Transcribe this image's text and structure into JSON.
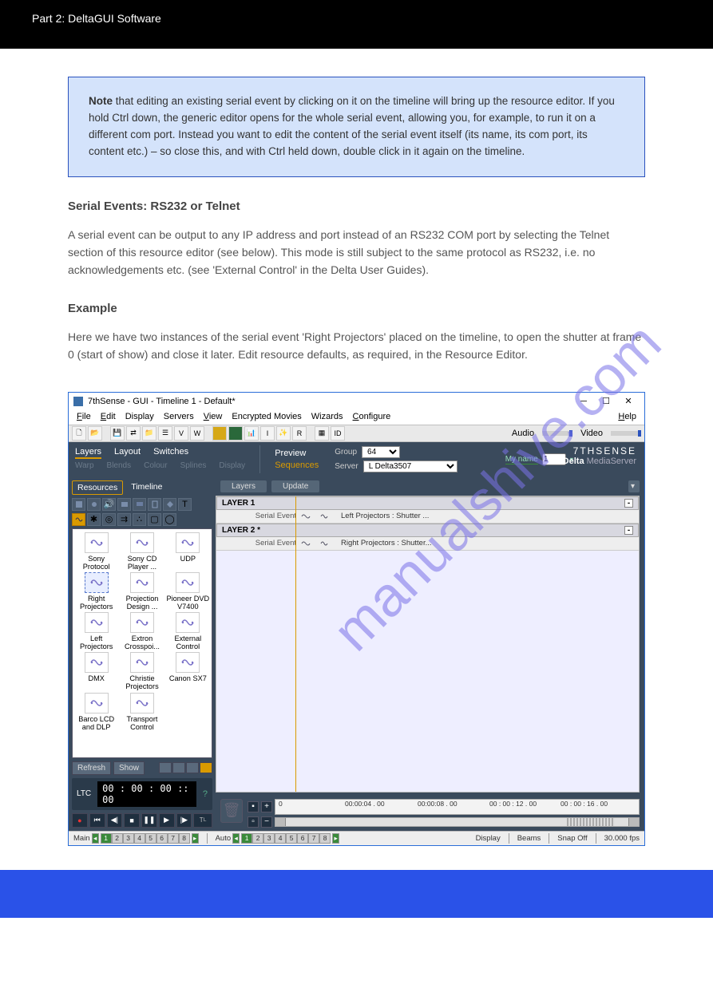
{
  "header": {
    "title": "Part 2: DeltaGUI Software"
  },
  "note": {
    "label": "Note",
    "text": " that editing an existing serial event by clicking on it on the timeline will bring up the resource editor. If you hold Ctrl down, the generic editor opens for the whole serial event, allowing you, for example, to run it on a different com port. Instead you want to edit the content of the serial event itself (its name, its com port, its content etc.) – so close this, and with Ctrl held down, double click in it again on the timeline."
  },
  "body": {
    "h1": "Serial Events: RS232 or Telnet",
    "p1": "A serial event can be output to any IP address and port instead of an RS232 COM port by selecting the Telnet section of this resource editor (see below). This mode is still subject to the same protocol as RS232, i.e. no acknowledgements etc. (see 'External Control' in the Delta User Guides).",
    "h2": "Example",
    "p2": "Here we have two instances of the serial event 'Right Projectors' placed on the timeline, to open the shutter at frame 0 (start of show) and close it later. Edit resource defaults, as required, in the Resource Editor."
  },
  "app": {
    "title": "7thSense -   GUI  - Timeline 1  - Default*",
    "menubar": [
      "File",
      "Edit",
      "Display",
      "Servers",
      "View",
      "Encrypted Movies",
      "Wizards",
      "Configure"
    ],
    "menubar_help": "Help",
    "toolbar_audio": "Audio",
    "toolbar_video": "Video",
    "tabs_main": [
      "Layers",
      "Layout",
      "Switches"
    ],
    "tabs_sub": [
      "Warp",
      "Blends",
      "Colour",
      "Splines",
      "Display"
    ],
    "mid": {
      "preview": "Preview",
      "sequences": "Sequences"
    },
    "group_label": "Group",
    "group_value": "64",
    "server_label": "Server",
    "server_value": "L   Delta3507",
    "myname_label": "My name",
    "myname_value": "1",
    "brand_logo": "7THSENSE",
    "brand_sub_a": "Delta",
    "brand_sub_b": " MediaServer",
    "res_tabs": {
      "resources": "Resources",
      "timeline": "Timeline"
    },
    "resources": [
      {
        "name": "Sony Protocol"
      },
      {
        "name": "Sony CD Player ..."
      },
      {
        "name": "UDP"
      },
      {
        "name": "Right Projectors",
        "selected": true
      },
      {
        "name": "Projection Design ..."
      },
      {
        "name": "Pioneer DVD V7400"
      },
      {
        "name": "Left Projectors"
      },
      {
        "name": "Extron Crosspoi..."
      },
      {
        "name": "External Control"
      },
      {
        "name": "DMX"
      },
      {
        "name": "Christie Projectors"
      },
      {
        "name": "Canon SX7"
      },
      {
        "name": "Barco LCD and DLP"
      },
      {
        "name": "Transport Control"
      }
    ],
    "left_buttons": {
      "refresh": "Refresh",
      "show": "Show"
    },
    "ltc": {
      "label": "LTC",
      "time": "00 : 00 : 00 :: 00"
    },
    "tl_header": {
      "layers": "Layers",
      "update": "Update"
    },
    "layer1": {
      "head": "LAYER 1",
      "track": "Serial Event",
      "clip": "Left Projectors : Shutter ..."
    },
    "layer2": {
      "head": "LAYER 2 *",
      "track": "Serial Event",
      "clip": "Right Projectors : Shutter..."
    },
    "ruler": {
      "t0": "0",
      "t1": "00:00:04 . 00",
      "t2": "00:00:08 . 00",
      "t3": "00 : 00 : 12 . 00",
      "t4": "00 : 00 : 16 . 00"
    },
    "status": {
      "main": "Main",
      "auto": "Auto",
      "main_nums": [
        "1",
        "2",
        "3",
        "4",
        "5",
        "6",
        "7",
        "8"
      ],
      "auto_nums": [
        "1",
        "2",
        "3",
        "4",
        "5",
        "6",
        "7",
        "8"
      ],
      "display": "Display",
      "beams": "Beams",
      "snap": "Snap Off",
      "fps": "30.000 fps"
    }
  }
}
